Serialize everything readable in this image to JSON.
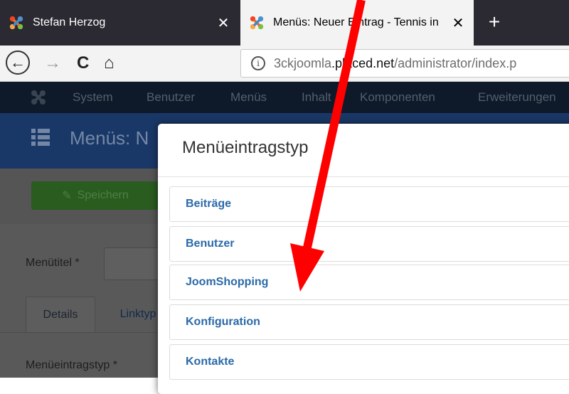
{
  "browser": {
    "tabs": [
      {
        "title": "Stefan Herzog",
        "close": "✕"
      },
      {
        "title": "Menüs: Neuer Eintrag - Tennis in",
        "close": "✕"
      }
    ],
    "new_tab": "+",
    "nav": {
      "back": "←",
      "forward": "→",
      "reload": "C",
      "home": "⌂"
    },
    "url": {
      "info_icon": "i",
      "prefix": "3ckjoomla",
      "host": ".placed.net",
      "path": "/administrator/index.p"
    }
  },
  "joomla": {
    "menu": [
      "System",
      "Benutzer",
      "Menüs",
      "Inhalt",
      "Komponenten",
      "Erweiterungen"
    ],
    "page_title": "Menüs: N",
    "save_button": "Speichern",
    "menu_title_label": "Menütitel *",
    "tabs": [
      "Details",
      "Linktyp"
    ],
    "menu_item_type_label": "Menüeintragstyp *"
  },
  "modal": {
    "title": "Menüeintragstyp",
    "items": [
      "Beiträge",
      "Benutzer",
      "JoomShopping",
      "Konfiguration",
      "Kontakte"
    ]
  },
  "colors": {
    "annotation_arrow": "#ff0000",
    "link": "#2a69a8",
    "browser_dark": "#2b2a33",
    "joomla_header": "#1a3867"
  }
}
